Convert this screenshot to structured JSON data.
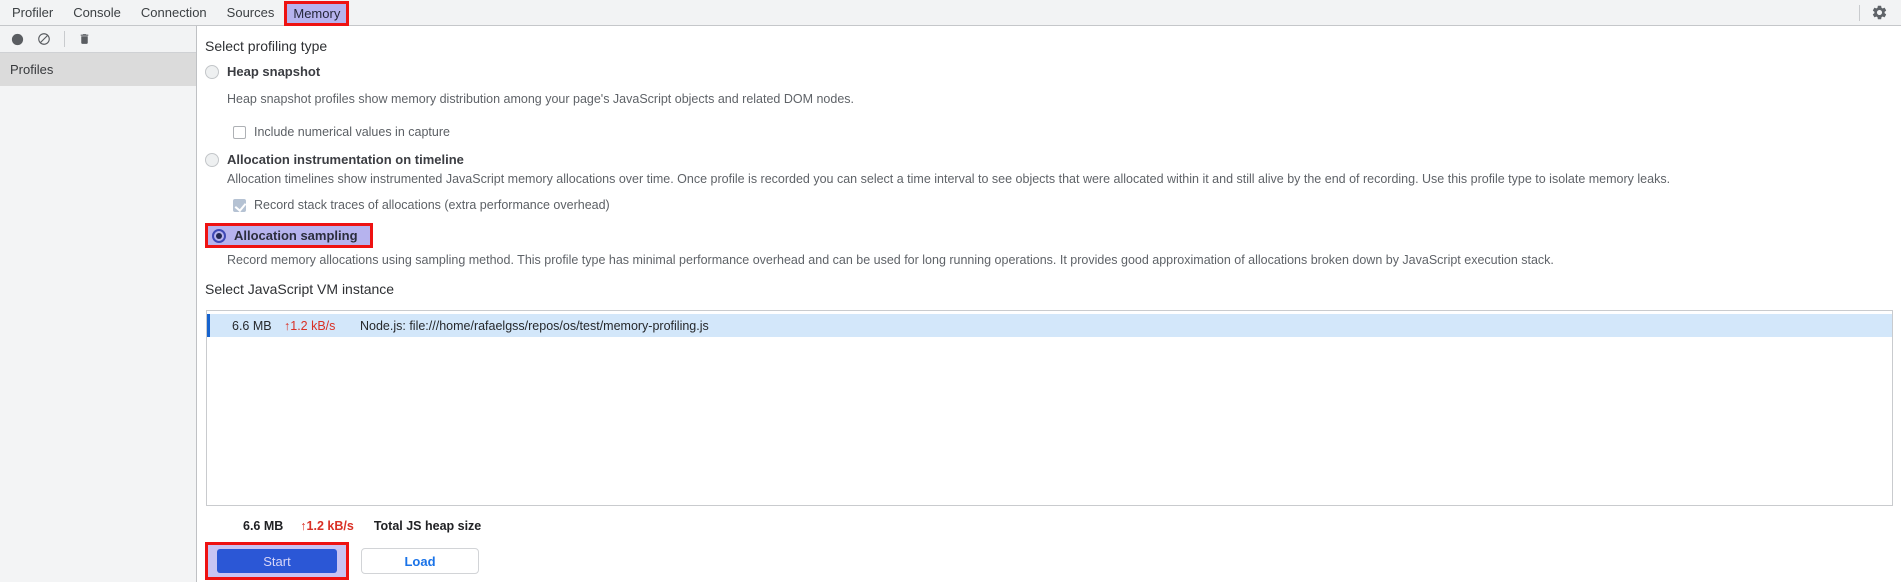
{
  "tab_bar": {
    "tabs": [
      "Profiler",
      "Console",
      "Connection",
      "Sources",
      "Memory"
    ],
    "active_tab": "Memory"
  },
  "toolbar_icons": [
    "record-icon",
    "block-icon",
    "trash-icon"
  ],
  "header_icons": [
    "gear-icon"
  ],
  "sidebar": {
    "profiles_header": "Profiles"
  },
  "profiling": {
    "heading": "Select profiling type",
    "selected_option": "Allocation sampling",
    "options": [
      {
        "label": "Heap snapshot",
        "description": "Heap snapshot profiles show memory distribution among your page's JavaScript objects and related DOM nodes.",
        "checkbox_label": "Include numerical values in capture",
        "checkbox_checked": false,
        "selected": false
      },
      {
        "label": "Allocation instrumentation on timeline",
        "description": "Allocation timelines show instrumented JavaScript memory allocations over time. Once profile is recorded you can select a time interval to see objects that were allocated within it and still alive by the end of recording. Use this profile type to isolate memory leaks.",
        "checkbox_label": "Record stack traces of allocations (extra performance overhead)",
        "checkbox_checked": true,
        "selected": false
      },
      {
        "label": "Allocation sampling",
        "description": "Record memory allocations using sampling method. This profile type has minimal performance overhead and can be used for long running operations. It provides good approximation of allocations broken down by JavaScript execution stack.",
        "selected": true
      }
    ]
  },
  "vm_section": {
    "heading": "Select JavaScript VM instance",
    "instances": [
      {
        "heap_size": "6.6 MB",
        "rate": "↑1.2 kB/s",
        "name": "Node.js: file:///home/rafaelgss/repos/os/test/memory-profiling.js",
        "selected": true
      }
    ],
    "total": {
      "heap_size": "6.6 MB",
      "rate": "↑1.2 kB/s",
      "label": "Total JS heap size"
    }
  },
  "actions": {
    "start_label": "Start",
    "load_label": "Load"
  },
  "colors": {
    "annotation_red": "#ee1212",
    "highlight_lavender": "#b6b3ee",
    "selected_row_blue": "#d3e7fa",
    "row_accent_blue": "#1764ce",
    "rate_red": "#d93025",
    "start_button_blue": "#2b57d6",
    "load_text_blue": "#1a73e8"
  }
}
